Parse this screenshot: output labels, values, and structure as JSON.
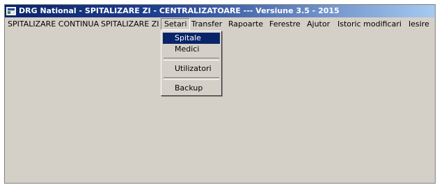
{
  "window": {
    "title": "DRG National - SPITALIZARE ZI - CENTRALIZATOARE  --- Versiune 3.5 - 2015"
  },
  "menubar": {
    "items": [
      {
        "label": "SPITALIZARE CONTINUA"
      },
      {
        "label": "SPITALIZARE ZI"
      },
      {
        "label": "Setari"
      },
      {
        "label": "Transfer"
      },
      {
        "label": "Rapoarte"
      },
      {
        "label": "Ferestre"
      },
      {
        "label": "Ajutor"
      },
      {
        "label": "Istoric modificari"
      },
      {
        "label": "Iesire"
      }
    ],
    "open_menu": "Setari"
  },
  "dropdown": {
    "items": [
      {
        "label": "Spitale"
      },
      {
        "label": "Medici"
      },
      {
        "label": "Utilizatori"
      },
      {
        "label": "Backup"
      }
    ],
    "highlighted": "Spitale"
  },
  "colors": {
    "title_bar": "#0a246a",
    "highlight": "#0a246a",
    "face": "#d4d0c8"
  }
}
